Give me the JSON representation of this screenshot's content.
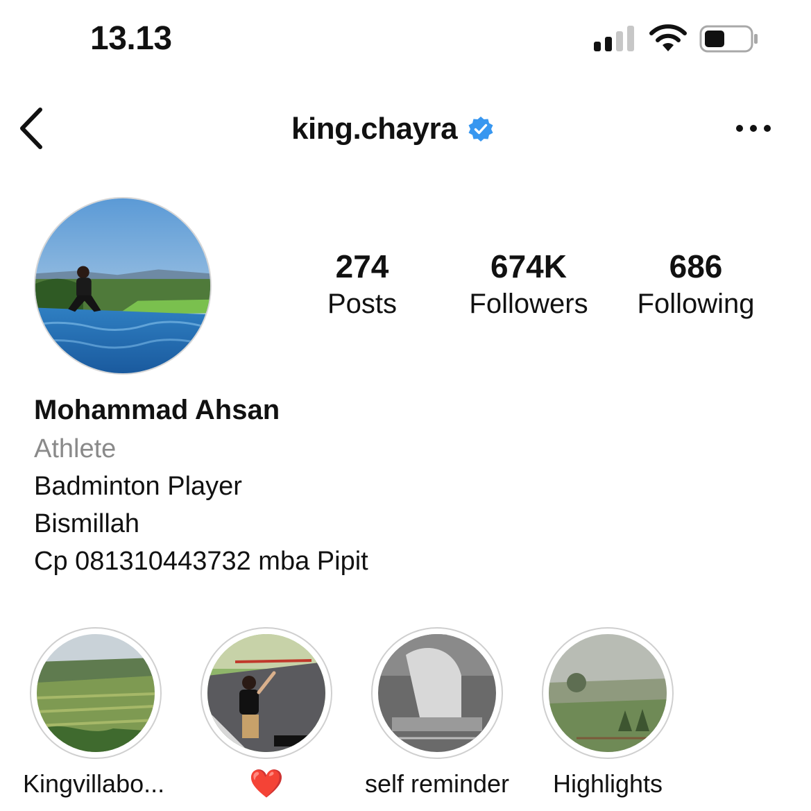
{
  "status_bar": {
    "time": "13.13",
    "signal_icon": "cellular-signal-icon",
    "wifi_icon": "wifi-icon",
    "battery_icon": "battery-icon"
  },
  "header": {
    "back_icon": "chevron-left-icon",
    "username": "king.chayra",
    "verified_icon": "verified-badge-icon",
    "verified_color": "#3897f0",
    "more_icon": "more-horizontal-icon"
  },
  "profile": {
    "stats": [
      {
        "value": "274",
        "label": "Posts"
      },
      {
        "value": "674K",
        "label": "Followers"
      },
      {
        "value": "686",
        "label": "Following"
      }
    ],
    "name": "Mohammad Ahsan",
    "category": "Athlete",
    "bio_lines": [
      "Badminton Player",
      "Bismillah",
      "Cp 081310443732 mba Pipit"
    ]
  },
  "highlights": [
    {
      "label": "Kingvillabo..."
    },
    {
      "label": "❤️"
    },
    {
      "label": "self reminder"
    },
    {
      "label": "Highlights"
    }
  ]
}
